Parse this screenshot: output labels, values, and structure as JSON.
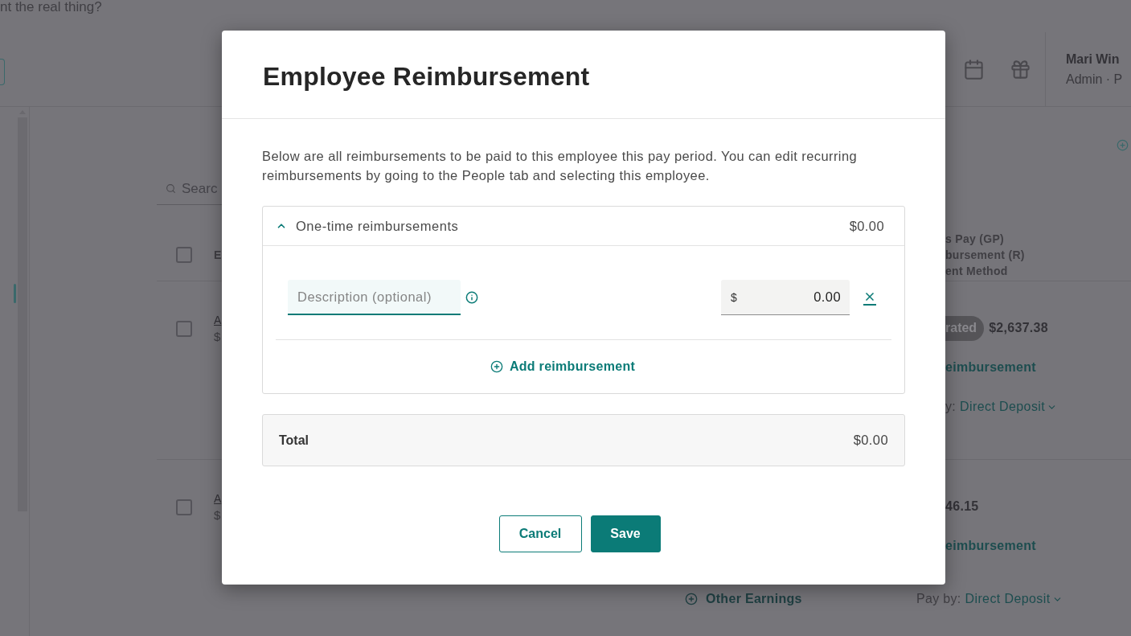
{
  "background": {
    "banner": "nt the real thing?",
    "header": {
      "user_name": "Mari Win",
      "user_role": "Admin · P"
    },
    "search": {
      "placeholder": "Searc"
    },
    "table": {
      "header": {
        "checked": false,
        "column_1": "E",
        "column_2": [
          "s Pay (GP)",
          "bursement (R)",
          "ent Method"
        ]
      },
      "rows": [
        {
          "checked": false,
          "name": "A",
          "amount": "$",
          "badge": "rated",
          "total": "$2,637.38",
          "reimbursement": "eimbursement",
          "pay_by_label": "y:",
          "pay_method": "Direct Deposit"
        },
        {
          "checked": false,
          "name": "A",
          "amount": "$",
          "total": "46.15",
          "reimbursement": "eimbursement",
          "other_earnings": "Other Earnings",
          "pay_by_label": "Pay by:",
          "pay_method": "Direct Deposit"
        }
      ]
    }
  },
  "modal": {
    "title": "Employee Reimbursement",
    "intro": "Below are all reimbursements to be paid to this employee this pay period. You can edit recurring reimbursements by going to the People tab and selecting this employee.",
    "section": {
      "title": "One-time reimbursements",
      "amount": "$0.00",
      "expanded": true,
      "items": [
        {
          "description": {
            "placeholder": "Description (optional)",
            "focused": true
          },
          "amount": {
            "currency": "$",
            "value": "0.00"
          }
        }
      ],
      "add_label": "Add reimbursement"
    },
    "total": {
      "label": "Total",
      "amount": "$0.00"
    },
    "buttons": [
      {
        "label": "Cancel",
        "kind": "secondary"
      },
      {
        "label": "Save",
        "kind": "primary"
      }
    ]
  }
}
